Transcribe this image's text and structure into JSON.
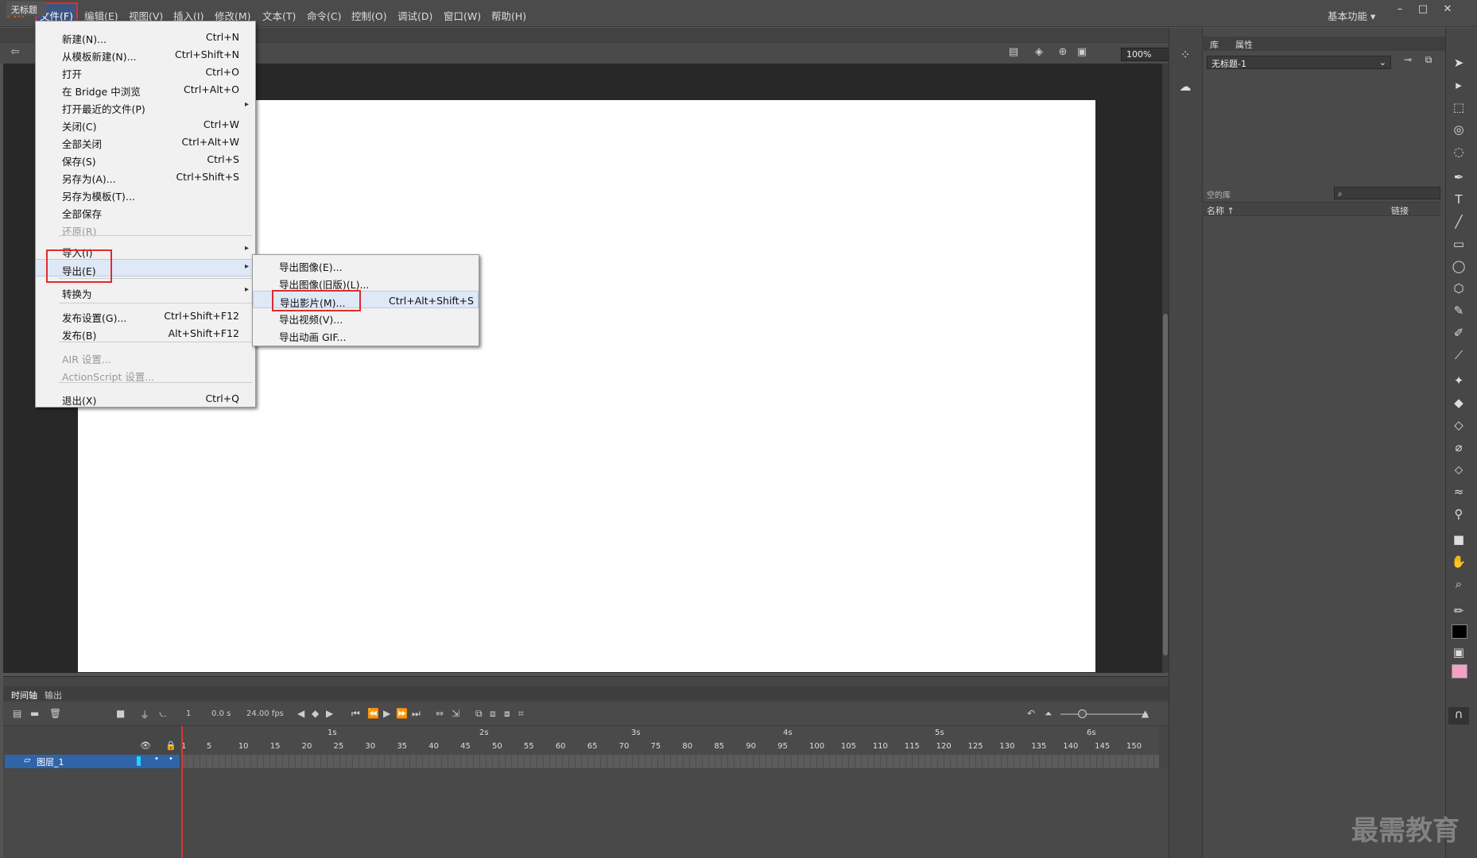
{
  "app": {
    "logo": "An",
    "workspace": "基本功能"
  },
  "menubar": [
    "文件(F)",
    "编辑(E)",
    "视图(V)",
    "插入(I)",
    "修改(M)",
    "文本(T)",
    "命令(C)",
    "控制(O)",
    "调试(D)",
    "窗口(W)",
    "帮助(H)"
  ],
  "document": {
    "tab": "无标题",
    "zoom": "100%"
  },
  "file_menu": [
    {
      "label": "新建(N)...",
      "shortcut": "Ctrl+N"
    },
    {
      "label": "从模板新建(N)...",
      "shortcut": "Ctrl+Shift+N"
    },
    {
      "label": "打开",
      "shortcut": "Ctrl+O"
    },
    {
      "label": "在 Bridge 中浏览",
      "shortcut": "Ctrl+Alt+O"
    },
    {
      "label": "打开最近的文件(P)",
      "shortcut": ""
    },
    {
      "label": "关闭(C)",
      "shortcut": "Ctrl+W"
    },
    {
      "label": "全部关闭",
      "shortcut": "Ctrl+Alt+W"
    },
    {
      "label": "保存(S)",
      "shortcut": "Ctrl+S"
    },
    {
      "label": "另存为(A)...",
      "shortcut": "Ctrl+Shift+S"
    },
    {
      "label": "另存为模板(T)...",
      "shortcut": ""
    },
    {
      "label": "全部保存",
      "shortcut": ""
    },
    {
      "label": "还原(R)",
      "shortcut": ""
    },
    {
      "label": "导入(I)",
      "shortcut": ""
    },
    {
      "label": "导出(E)",
      "shortcut": ""
    },
    {
      "label": "转换为",
      "shortcut": ""
    },
    {
      "label": "发布设置(G)...",
      "shortcut": "Ctrl+Shift+F12"
    },
    {
      "label": "发布(B)",
      "shortcut": "Alt+Shift+F12"
    },
    {
      "label": "AIR 设置...",
      "shortcut": ""
    },
    {
      "label": "ActionScript 设置...",
      "shortcut": ""
    },
    {
      "label": "退出(X)",
      "shortcut": "Ctrl+Q"
    }
  ],
  "export_submenu": [
    {
      "label": "导出图像(E)...",
      "shortcut": ""
    },
    {
      "label": "导出图像(旧版)(L)...",
      "shortcut": ""
    },
    {
      "label": "导出影片(M)...",
      "shortcut": "Ctrl+Alt+Shift+S"
    },
    {
      "label": "导出视频(V)...",
      "shortcut": ""
    },
    {
      "label": "导出动画 GIF...",
      "shortcut": ""
    }
  ],
  "right_panel": {
    "tabs": [
      "库",
      "属性"
    ],
    "doc_select": "无标题-1",
    "library_label": "空的库",
    "col_name": "名称 ↑",
    "col_link": "链接"
  },
  "timeline": {
    "tabs": [
      "时间轴",
      "输出"
    ],
    "frame": "1",
    "time": "0.0 s",
    "fps": "24.00 fps",
    "seconds": [
      "1s",
      "2s",
      "3s",
      "4s",
      "5s",
      "6s"
    ],
    "frame_numbers": [
      "1",
      "5",
      "10",
      "15",
      "20",
      "25",
      "30",
      "35",
      "40",
      "45",
      "50",
      "55",
      "60",
      "65",
      "70",
      "75",
      "80",
      "85",
      "90",
      "95",
      "100",
      "105",
      "110",
      "115",
      "120",
      "125",
      "130",
      "135",
      "140",
      "145",
      "150"
    ],
    "layer": "图层_1"
  },
  "watermark": "最需教育"
}
